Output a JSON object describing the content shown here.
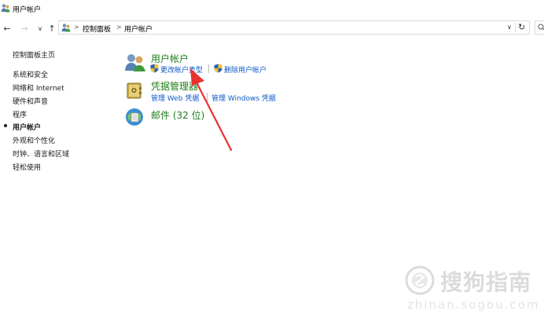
{
  "window": {
    "title": "用户帐户"
  },
  "address": {
    "crumbs": [
      "控制面板",
      "用户帐户"
    ],
    "separator": ">"
  },
  "nav": {
    "back": "←",
    "forward": "→",
    "recent": "∨",
    "up": "↑",
    "dropdown": "∨",
    "refresh": "↻"
  },
  "sidebar": {
    "home": "控制面板主页",
    "items": [
      {
        "label": "系统和安全"
      },
      {
        "label": "网络和 Internet"
      },
      {
        "label": "硬件和声音"
      },
      {
        "label": "程序"
      },
      {
        "label": "用户帐户",
        "current": true
      },
      {
        "label": "外观和个性化"
      },
      {
        "label": "时钟、语言和区域"
      },
      {
        "label": "轻松使用"
      }
    ]
  },
  "categories": [
    {
      "title": "用户帐户",
      "links": [
        "更改帐户类型",
        "删除用户帐户"
      ]
    },
    {
      "title": "凭据管理器",
      "links": [
        "管理 Web 凭据",
        "管理 Windows 凭据"
      ]
    },
    {
      "title": "邮件 (32 位)",
      "links": []
    }
  ],
  "watermark": {
    "text": "搜狗指南",
    "url": "zhinan.sogou.com"
  },
  "colors": {
    "category": "#1e7e16",
    "link": "#0d5ac9",
    "arrow": "#e8312f"
  }
}
